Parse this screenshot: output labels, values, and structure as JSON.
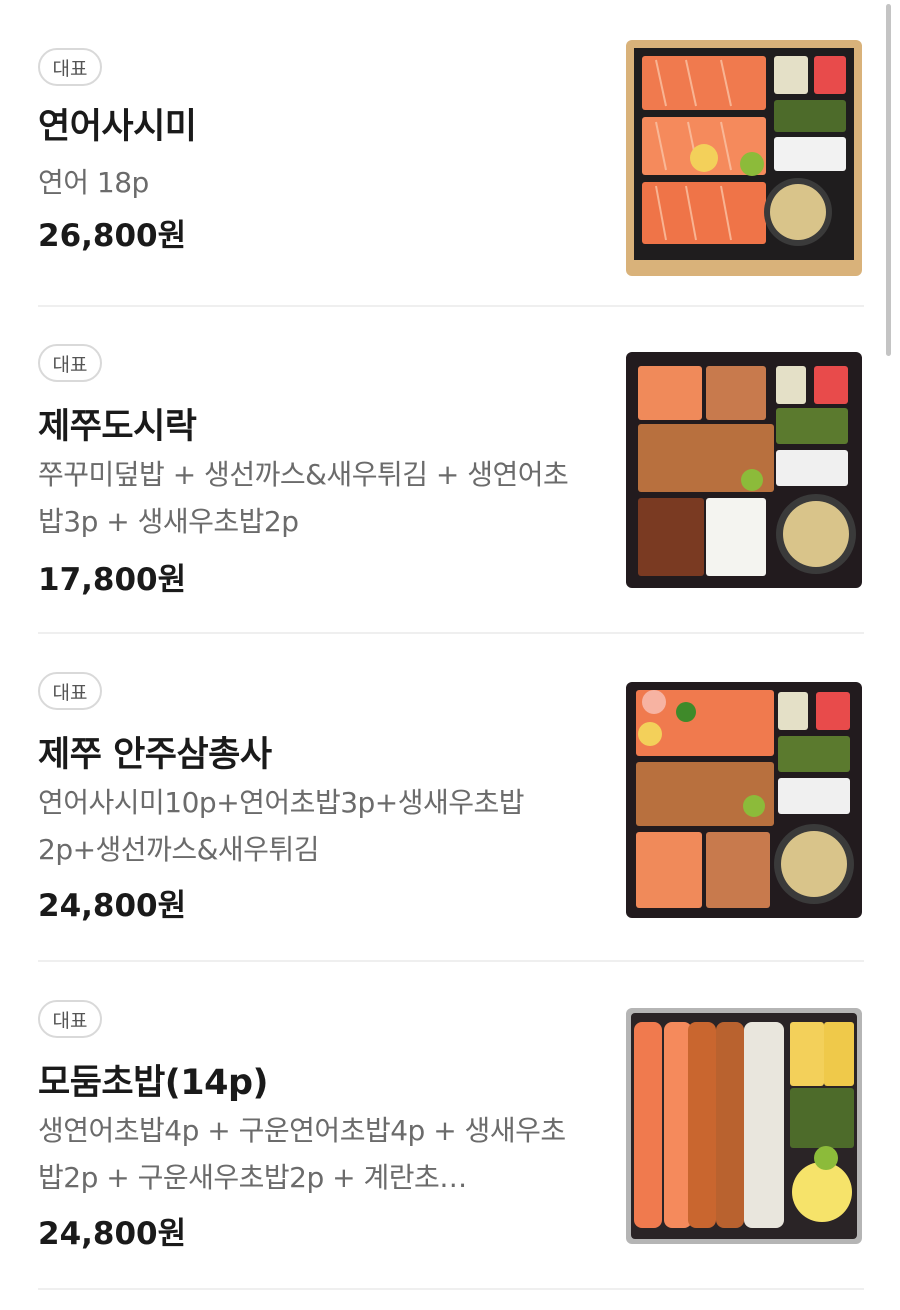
{
  "items": [
    {
      "badge": "대표",
      "name": "연어사시미",
      "desc": "연어 18p",
      "price": "26,800원",
      "image": "salmon-sashimi-box"
    },
    {
      "badge": "대표",
      "name": "제쭈도시락",
      "desc": "쭈꾸미덮밥 + 생선까스&새우튀김 + 생연어초밥3p + 생새우초밥2p",
      "price": "17,800원",
      "image": "jejju-lunchbox"
    },
    {
      "badge": "대표",
      "name": "제쭈 안주삼총사",
      "desc": "연어사시미10p+연어초밥3p+생새우초밥2p+생선까스&새우튀김",
      "price": "24,800원",
      "image": "jejju-anju-trio-box"
    },
    {
      "badge": "대표",
      "name": "모둠초밥(14p)",
      "desc": "생연어초밥4p + 구운연어초밥4p + 생새우초밥2p + 구운새우초밥2p + 계란초…",
      "price": "24,800원",
      "image": "assorted-sushi-tray"
    }
  ]
}
